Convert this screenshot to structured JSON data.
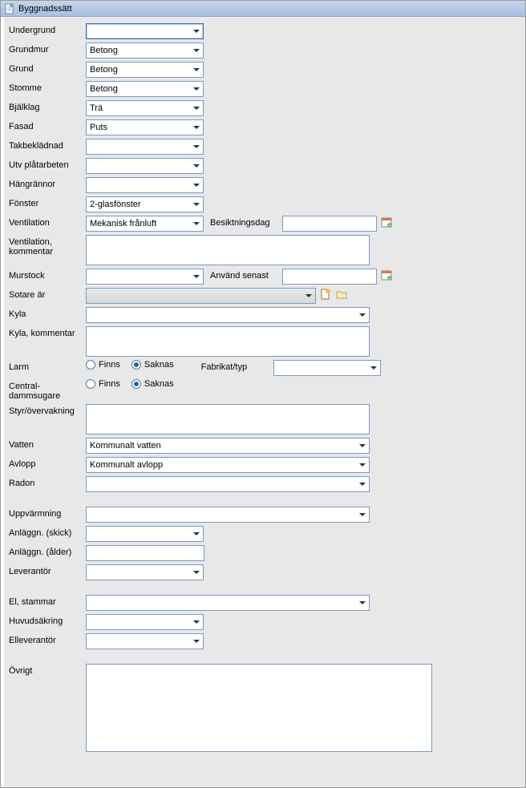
{
  "title": "Byggnadssätt",
  "labels": {
    "undergrund": "Undergrund",
    "grundmur": "Grundmur",
    "grund": "Grund",
    "stomme": "Stomme",
    "bjalklag": "Bjälklag",
    "fasad": "Fasad",
    "takbekladnad": "Takbeklädnad",
    "utv_platarbeten": "Utv plåtarbeten",
    "hangrannor": "Hängrännor",
    "fonster": "Fönster",
    "ventilation": "Ventilation",
    "besiktningsdag": "Besiktningsdag",
    "ventilation_kommentar": "Ventilation, kommentar",
    "murstock": "Murstock",
    "anvand_senast": "Använd senast",
    "sotare_ar": "Sotare är",
    "kyla": "Kyla",
    "kyla_kommentar": "Kyla, kommentar",
    "larm": "Larm",
    "fabrikat_typ": "Fabrikat/typ",
    "central_dammsugare": "Central-dammsugare",
    "styr_overvakning": "Styr/övervakning",
    "vatten": "Vatten",
    "avlopp": "Avlopp",
    "radon": "Radon",
    "uppvarmning": "Uppvärmning",
    "anlaggn_skick": "Anläggn. (skick)",
    "anlaggn_alder": "Anläggn. (ålder)",
    "leverantor": "Leverantör",
    "el_stammar": "El, stammar",
    "huvudsakring": "Huvudsäkring",
    "elleverantor": "Elleverantör",
    "ovrigt": "Övrigt"
  },
  "radio": {
    "finns": "Finns",
    "saknas": "Saknas"
  },
  "values": {
    "undergrund": "",
    "grundmur": "Betong",
    "grund": "Betong",
    "stomme": "Betong",
    "bjalklag": "Trä",
    "fasad": "Puts",
    "takbekladnad": "",
    "utv_platarbeten": "",
    "hangrannor": "",
    "fonster": "2-glasfönster",
    "ventilation": "Mekanisk frånluft",
    "besiktningsdag": "",
    "ventilation_kommentar": "",
    "murstock": "",
    "anvand_senast": "",
    "sotare_ar": "",
    "kyla": "",
    "kyla_kommentar": "",
    "larm": "saknas",
    "fabrikat_typ": "",
    "central_dammsugare": "saknas",
    "styr_overvakning": "",
    "vatten": "Kommunalt vatten",
    "avlopp": "Kommunalt avlopp",
    "radon": "",
    "uppvarmning": "",
    "anlaggn_skick": "",
    "anlaggn_alder": "",
    "leverantor": "",
    "el_stammar": "",
    "huvudsakring": "",
    "elleverantor": "",
    "ovrigt": ""
  }
}
